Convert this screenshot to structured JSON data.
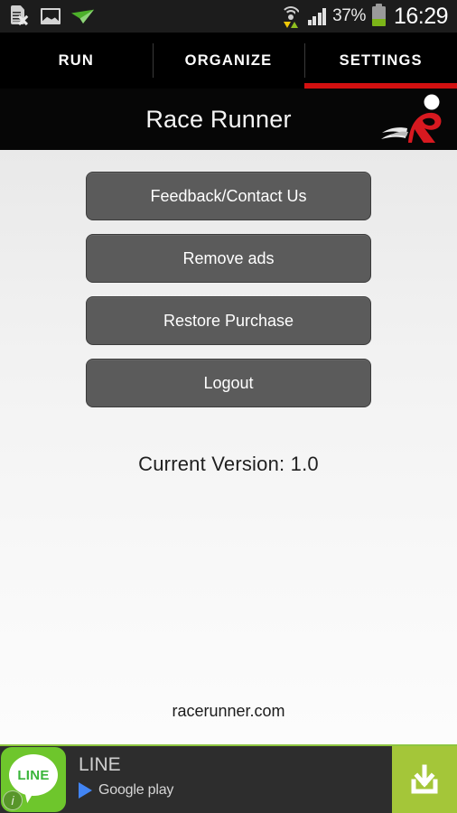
{
  "status_bar": {
    "left_icons": [
      {
        "name": "sim-card-error-icon",
        "label": "No SIM card"
      },
      {
        "name": "gallery-image-icon",
        "label": "Screenshot captured"
      },
      {
        "name": "paper-plane-icon",
        "label": "Message sent"
      }
    ],
    "wifi_icon": "wifi-transfer-icon",
    "signal_icon": "cellular-signal-icon",
    "battery_percent": "37%",
    "battery_level": 37,
    "battery_icon": "battery-icon",
    "time": "16:29"
  },
  "tabs": [
    {
      "label": "RUN",
      "active": false
    },
    {
      "label": "ORGANIZE",
      "active": false
    },
    {
      "label": "SETTINGS",
      "active": true
    }
  ],
  "header": {
    "title": "Race Runner",
    "logo_name": "race-runner-logo"
  },
  "main": {
    "buttons": [
      {
        "label": "Feedback/Contact Us",
        "name": "feedback-contact-button"
      },
      {
        "label": "Remove ads",
        "name": "remove-ads-button"
      },
      {
        "label": "Restore Purchase",
        "name": "restore-purchase-button"
      },
      {
        "label": "Logout",
        "name": "logout-button"
      }
    ],
    "version_text": "Current Version:  1.0",
    "website": "racerunner.com"
  },
  "ad": {
    "icon_text": "LINE",
    "title": "LINE",
    "store_label": "Google play",
    "info_badge": "i",
    "cta_icon": "download-icon"
  },
  "colors": {
    "accent_red": "#d21010",
    "button_gray": "#5b5b5b",
    "ad_green": "#a4c639",
    "line_green": "#6ec62c",
    "content_bg_top": "#e9e9e9",
    "content_bg_bottom": "#fcfcfc"
  }
}
